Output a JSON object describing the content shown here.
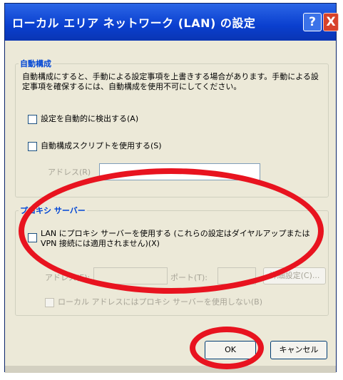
{
  "window": {
    "title": "ローカル エリア ネットワーク (LAN) の設定",
    "help_label": "?",
    "close_label": "X"
  },
  "auto_config": {
    "legend": "自動構成",
    "description": "自動構成にすると、手動による設定事項を上書きする場合があります。手動による設定事項を確保するには、自動構成を使用不可にしてください。",
    "detect_label": "設定を自動的に検出する(A)",
    "script_label": "自動構成スクリプトを使用する(S)",
    "address_label": "アドレス(R)",
    "address_value": ""
  },
  "proxy": {
    "legend": "プロキシ サーバー",
    "use_proxy_label": "LAN にプロキシ サーバーを使用する (これらの設定はダイヤルアップまたは VPN 接続には適用されません)(X)",
    "address_label": "アドレス(E):",
    "address_value": "",
    "port_label": "ポート(T):",
    "port_value": "",
    "advanced_label": "詳細設定(C)...",
    "bypass_label": "ローカル アドレスにはプロキシ サーバーを使用しない(B)"
  },
  "buttons": {
    "ok_label": "OK",
    "cancel_label": "キャンセル"
  },
  "annotation": {
    "color": "#e8131f"
  }
}
